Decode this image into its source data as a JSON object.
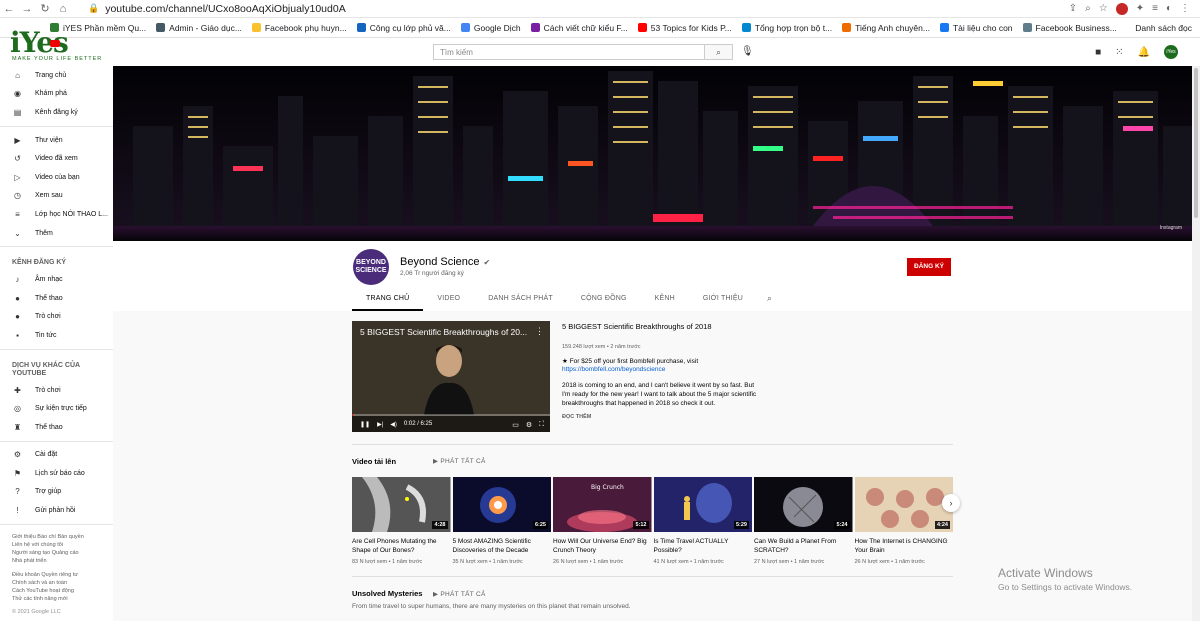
{
  "browser": {
    "url": "youtube.com/channel/UCxo8ooAqXiObjualy10ud0A",
    "bookmarks": [
      {
        "label": "iYES Phần mềm Qu...",
        "color": "#2e7d32"
      },
      {
        "label": "Admin - Giáo dục...",
        "color": "#455a64"
      },
      {
        "label": "Facebook phụ huyn...",
        "color": "#fbc02d"
      },
      {
        "label": "Công cụ lớp phủ vă...",
        "color": "#1565c0"
      },
      {
        "label": "Google Dịch",
        "color": "#4285f4"
      },
      {
        "label": "Cách viết chữ kiểu F...",
        "color": "#7b1fa2"
      },
      {
        "label": "53 Topics for Kids P...",
        "color": "#ff0000"
      },
      {
        "label": "Tổng hợp trọn bộ t...",
        "color": "#0288d1"
      },
      {
        "label": "Tiếng Anh chuyên...",
        "color": "#ef6c00"
      },
      {
        "label": "Tài liệu cho con",
        "color": "#1877f2"
      },
      {
        "label": "Facebook Business...",
        "color": "#607d8b"
      }
    ],
    "bookmarks_right": "Danh sách đọc"
  },
  "logo": {
    "text": "iYes",
    "tagline": "MAKE YOUR LIFE BETTER"
  },
  "search": {
    "placeholder": "Tìm kiếm"
  },
  "sidebar": {
    "main": [
      {
        "icon": "home-icon",
        "glyph": "⌂",
        "label": "Trang chủ"
      },
      {
        "icon": "explore-icon",
        "glyph": "◉",
        "label": "Khám phá"
      },
      {
        "icon": "subscriptions-icon",
        "glyph": "▤",
        "label": "Kênh đăng ký"
      }
    ],
    "library": [
      {
        "icon": "library-icon",
        "glyph": "▶",
        "label": "Thư viện"
      },
      {
        "icon": "history-icon",
        "glyph": "↺",
        "label": "Video đã xem"
      },
      {
        "icon": "your-videos-icon",
        "glyph": "▷",
        "label": "Video của bạn"
      },
      {
        "icon": "watch-later-icon",
        "glyph": "◷",
        "label": "Xem sau"
      },
      {
        "icon": "playlist-icon",
        "glyph": "≡",
        "label": "Lớp học NÓI THAO L..."
      },
      {
        "icon": "chevron-down-icon",
        "glyph": "⌄",
        "label": "Thêm"
      }
    ],
    "subs_heading": "KÊNH ĐĂNG KÝ",
    "subs": [
      {
        "icon": "music-icon",
        "glyph": "♪",
        "label": "Âm nhạc"
      },
      {
        "icon": "sports-icon",
        "glyph": "●",
        "label": "Thể thao"
      },
      {
        "icon": "gaming-icon",
        "glyph": "●",
        "label": "Trò chơi"
      },
      {
        "icon": "news-icon",
        "glyph": "▪",
        "label": "Tin tức"
      }
    ],
    "more_heading": "DỊCH VỤ KHÁC CỦA YOUTUBE",
    "more": [
      {
        "icon": "gaming-icon",
        "glyph": "✚",
        "label": "Trò chơi"
      },
      {
        "icon": "live-icon",
        "glyph": "◎",
        "label": "Sự kiện trực tiếp"
      },
      {
        "icon": "trophy-icon",
        "glyph": "♜",
        "label": "Thể thao"
      }
    ],
    "settings": [
      {
        "icon": "settings-icon",
        "glyph": "⚙",
        "label": "Cài đặt"
      },
      {
        "icon": "flag-icon",
        "glyph": "⚑",
        "label": "Lịch sử báo cáo"
      },
      {
        "icon": "help-icon",
        "glyph": "?",
        "label": "Trợ giúp"
      },
      {
        "icon": "feedback-icon",
        "glyph": "!",
        "label": "Gửi phản hồi"
      }
    ],
    "footer1": [
      "Giới thiệu  Báo chí  Bản quyền",
      "Liên hệ với chúng tôi",
      "Người sáng tạo  Quảng cáo",
      "Nhà phát triển"
    ],
    "footer2": [
      "Điều khoản  Quyền riêng tư",
      "Chính sách và an toàn",
      "Cách YouTube hoạt động",
      "Thử các tính năng mới"
    ],
    "copyright": "© 2021 Google LLC"
  },
  "banner": {
    "watermark": "Instagram"
  },
  "channel": {
    "name": "Beyond Science",
    "avatar_text": "BEYOND SCIENCE",
    "subscribers": "2,06 Tr người đăng ký",
    "subscribe_label": "ĐĂNG KÝ",
    "tabs": [
      "TRANG CHỦ",
      "VIDEO",
      "DANH SÁCH PHÁT",
      "CỘNG ĐỒNG",
      "KÊNH",
      "GIỚI THIỆU"
    ]
  },
  "featured": {
    "overlay_title": "5 BIGGEST Scientific Breakthroughs of 20...",
    "time": "0:02 / 6:25",
    "title": "5 BIGGEST Scientific Breakthroughs of 2018",
    "meta": "159.248 lượt xem • 2 năm trước",
    "promo": "★ For $25 off your first Bombfell purchase, visit",
    "link": "https://bombfell.com/beyondscience",
    "desc": "2018 is coming to an end, and I can't believe it went by so fast. But I'm ready for the new year! I want to talk about the 5 major scientific breakthroughs that happened in 2018 so check it out.",
    "read_more": "ĐỌC THÊM",
    "progress": 0.005
  },
  "uploads": {
    "title": "Video tải lên",
    "play_all": "PHÁT TẤT CẢ",
    "videos": [
      {
        "title": "Are Cell Phones Mutating the Shape of Our Bones?",
        "meta": "83 N lượt xem • 1 năm trước",
        "duration": "4:28",
        "bg": "#3c3c3c"
      },
      {
        "title": "5 Most AMAZING Scientific Discoveries of the Decade",
        "meta": "35 N lượt xem • 1 năm trước",
        "duration": "6:25",
        "bg": "#0b0b2b"
      },
      {
        "title": "How Will Our Universe End? Big Crunch Theory",
        "meta": "26 N lượt xem • 1 năm trước",
        "duration": "5:12",
        "bg": "#4a1a3a",
        "label": "Big Crunch"
      },
      {
        "title": "Is Time Travel ACTUALLY Possible?",
        "meta": "41 N lượt xem • 1 năm trước",
        "duration": "5:29",
        "bg": "#2a2a6a"
      },
      {
        "title": "Can We Build a Planet From SCRATCH?",
        "meta": "27 N lượt xem • 1 năm trước",
        "duration": "5:24",
        "bg": "#111111"
      },
      {
        "title": "How The Internet is CHANGING Your Brain",
        "meta": "26 N lượt xem • 1 năm trước",
        "duration": "4:24",
        "bg": "#d9c4a8"
      }
    ]
  },
  "unsolved": {
    "title": "Unsolved Mysteries",
    "play_all": "PHÁT TẤT CẢ",
    "desc": "From time travel to super humans, there are many mysteries on this planet that remain unsolved."
  },
  "windows": {
    "line1": "Activate Windows",
    "line2": "Go to Settings to activate Windows."
  }
}
